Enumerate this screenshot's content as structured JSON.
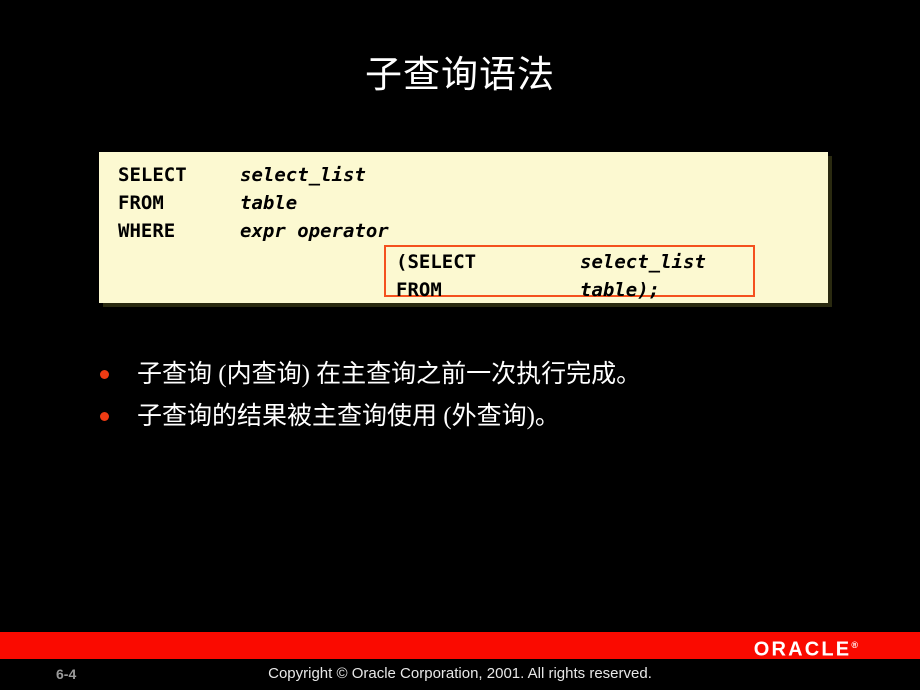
{
  "slide": {
    "title": "子查询语法",
    "background_color": "#000000",
    "title_color": "#ffffff"
  },
  "code_block": {
    "background_color": "#FCF9D1",
    "outer_query": [
      {
        "keyword": "SELECT",
        "param": "select_list"
      },
      {
        "keyword": "FROM",
        "param": "table"
      },
      {
        "keyword": "WHERE",
        "param": "expr operator"
      }
    ],
    "inner_query": {
      "border_color": "#F4511E",
      "lines": [
        {
          "keyword": "(SELECT",
          "param": "select_list"
        },
        {
          "keyword": "FROM",
          "param": "table);"
        }
      ]
    }
  },
  "bullets": {
    "bullet_color": "#EE3B13",
    "items": [
      "子查询 (内查询) 在主查询之前一次执行完成。",
      "子查询的结果被主查询使用 (外查询)。"
    ]
  },
  "footer": {
    "bar_color": "#FA0A00",
    "logo": "ORACLE",
    "logo_tm": "®",
    "page_number": "6-4",
    "copyright": "Copyright © Oracle Corporation, 2001. All rights reserved."
  }
}
